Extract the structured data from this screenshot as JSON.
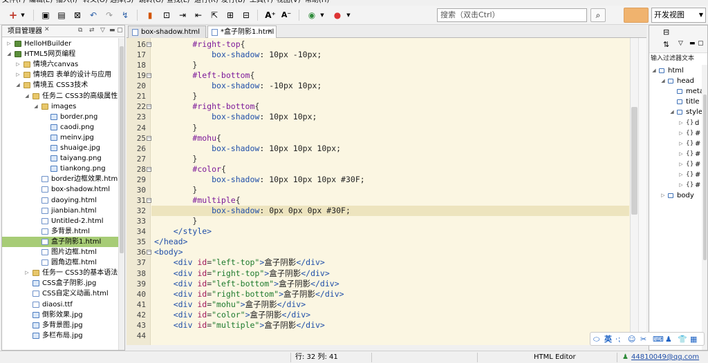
{
  "menu": [
    "文件(F)",
    "编辑(E)",
    "插入(I)",
    "转义(O)",
    "选择(S)",
    "跳转(G)",
    "查找(L)",
    "运行(R)",
    "发行(B)",
    "工具(T)",
    "视图(V)",
    "帮助(H)"
  ],
  "toolbar": {
    "search_placeholder": "搜索（双击Ctrl）",
    "view_select": "开发视图"
  },
  "left": {
    "title": "项目管理器",
    "tree": [
      {
        "label": "HelloHBuilder",
        "indent": 0,
        "arrow": "▷",
        "icon": "proj"
      },
      {
        "label": "HTML5网页编程",
        "indent": 0,
        "arrow": "◢",
        "icon": "proj"
      },
      {
        "label": "情境六canvas",
        "indent": 1,
        "arrow": "▷",
        "icon": "folder"
      },
      {
        "label": "情境四 表单的设计与应用",
        "indent": 1,
        "arrow": "▷",
        "icon": "folder"
      },
      {
        "label": "情境五 CSS3技术",
        "indent": 1,
        "arrow": "◢",
        "icon": "folder"
      },
      {
        "label": "任务二 CSS3的高级属性",
        "indent": 2,
        "arrow": "◢",
        "icon": "folder"
      },
      {
        "label": "images",
        "indent": 3,
        "arrow": "◢",
        "icon": "folder"
      },
      {
        "label": "border.png",
        "indent": 4,
        "arrow": "",
        "icon": "img"
      },
      {
        "label": "caodi.png",
        "indent": 4,
        "arrow": "",
        "icon": "img"
      },
      {
        "label": "meinv.jpg",
        "indent": 4,
        "arrow": "",
        "icon": "img"
      },
      {
        "label": "shuaige.jpg",
        "indent": 4,
        "arrow": "",
        "icon": "img"
      },
      {
        "label": "taiyang.png",
        "indent": 4,
        "arrow": "",
        "icon": "img"
      },
      {
        "label": "tiankong.png",
        "indent": 4,
        "arrow": "",
        "icon": "img"
      },
      {
        "label": "border边框效果.html",
        "indent": 3,
        "arrow": "",
        "icon": "file"
      },
      {
        "label": "box-shadow.html",
        "indent": 3,
        "arrow": "",
        "icon": "file"
      },
      {
        "label": "daoying.html",
        "indent": 3,
        "arrow": "",
        "icon": "file"
      },
      {
        "label": "jianbian.html",
        "indent": 3,
        "arrow": "",
        "icon": "file"
      },
      {
        "label": "Untitled-2.html",
        "indent": 3,
        "arrow": "",
        "icon": "file"
      },
      {
        "label": "多背景.html",
        "indent": 3,
        "arrow": "",
        "icon": "file"
      },
      {
        "label": "盒子阴影1.html",
        "indent": 3,
        "arrow": "",
        "icon": "file",
        "selected": true
      },
      {
        "label": "图片边框.html",
        "indent": 3,
        "arrow": "",
        "icon": "file"
      },
      {
        "label": "圆角边框.html",
        "indent": 3,
        "arrow": "",
        "icon": "file"
      },
      {
        "label": "任务一 CSS3的基本语法",
        "indent": 2,
        "arrow": "▷",
        "icon": "folder"
      },
      {
        "label": "CSS盒子阴影.jpg",
        "indent": 2,
        "arrow": "",
        "icon": "img"
      },
      {
        "label": "CSS自定义动画.html",
        "indent": 2,
        "arrow": "",
        "icon": "file"
      },
      {
        "label": "diaosi.ttf",
        "indent": 2,
        "arrow": "",
        "icon": "file"
      },
      {
        "label": "倒影效果.jpg",
        "indent": 2,
        "arrow": "",
        "icon": "img"
      },
      {
        "label": "多背景图.jpg",
        "indent": 2,
        "arrow": "",
        "icon": "img"
      },
      {
        "label": "多栏布局.jpg",
        "indent": 2,
        "arrow": "",
        "icon": "img"
      }
    ]
  },
  "tabs": [
    {
      "label": "box-shadow.html",
      "active": false
    },
    {
      "label": "*盒子阴影1.html",
      "active": true
    }
  ],
  "editor": {
    "current_line": 32,
    "lines": [
      {
        "n": "16",
        "fold": "−",
        "t": [
          [
            "        ",
            ""
          ],
          [
            "#right-top",
            "sel-c"
          ],
          [
            "{",
            "pun"
          ]
        ]
      },
      {
        "n": "17",
        "t": [
          [
            "            ",
            ""
          ],
          [
            "box-shadow",
            "prop"
          ],
          [
            ": 10px -10px;",
            "val"
          ]
        ]
      },
      {
        "n": "18",
        "t": [
          [
            "        ",
            ""
          ],
          [
            "}",
            "pun"
          ]
        ]
      },
      {
        "n": "19",
        "fold": "−",
        "t": [
          [
            "        ",
            ""
          ],
          [
            "#left-bottom",
            "sel-c"
          ],
          [
            "{",
            "pun"
          ]
        ]
      },
      {
        "n": "20",
        "t": [
          [
            "            ",
            ""
          ],
          [
            "box-shadow",
            "prop"
          ],
          [
            ": -10px 10px;",
            "val"
          ]
        ]
      },
      {
        "n": "21",
        "t": [
          [
            "        ",
            ""
          ],
          [
            "}",
            "pun"
          ]
        ]
      },
      {
        "n": "22",
        "fold": "−",
        "t": [
          [
            "        ",
            ""
          ],
          [
            "#right-bottom",
            "sel-c"
          ],
          [
            "{",
            "pun"
          ]
        ]
      },
      {
        "n": "23",
        "t": [
          [
            "            ",
            ""
          ],
          [
            "box-shadow",
            "prop"
          ],
          [
            ": 10px 10px;",
            "val"
          ]
        ]
      },
      {
        "n": "24",
        "t": [
          [
            "        ",
            ""
          ],
          [
            "}",
            "pun"
          ]
        ]
      },
      {
        "n": "25",
        "fold": "−",
        "t": [
          [
            "        ",
            ""
          ],
          [
            "#mohu",
            "sel-c"
          ],
          [
            "{",
            "pun"
          ]
        ]
      },
      {
        "n": "26",
        "t": [
          [
            "            ",
            ""
          ],
          [
            "box-shadow",
            "prop"
          ],
          [
            ": 10px 10px 10px;",
            "val"
          ]
        ]
      },
      {
        "n": "27",
        "t": [
          [
            "        ",
            ""
          ],
          [
            "}",
            "pun"
          ]
        ]
      },
      {
        "n": "28",
        "fold": "−",
        "t": [
          [
            "        ",
            ""
          ],
          [
            "#color",
            "sel-c"
          ],
          [
            "{",
            "pun"
          ]
        ]
      },
      {
        "n": "29",
        "t": [
          [
            "            ",
            ""
          ],
          [
            "box-shadow",
            "prop"
          ],
          [
            ": 10px 10px 10px #30F;",
            "val"
          ]
        ]
      },
      {
        "n": "30",
        "t": [
          [
            "        ",
            ""
          ],
          [
            "}",
            "pun"
          ]
        ]
      },
      {
        "n": "31",
        "fold": "−",
        "t": [
          [
            "        ",
            ""
          ],
          [
            "#multiple",
            "sel-c"
          ],
          [
            "{",
            "pun"
          ]
        ]
      },
      {
        "n": "32",
        "t": [
          [
            "            ",
            ""
          ],
          [
            "box-shadow",
            "prop"
          ],
          [
            ": 0px 0px 0px #30F;",
            "val"
          ]
        ]
      },
      {
        "n": "33",
        "t": [
          [
            "        ",
            ""
          ],
          [
            "}",
            "pun"
          ]
        ]
      },
      {
        "n": "34",
        "t": [
          [
            "    ",
            ""
          ],
          [
            "</style>",
            "tag"
          ]
        ]
      },
      {
        "n": "35",
        "t": [
          [
            "",
            ""
          ],
          [
            "</head>",
            "tag"
          ]
        ]
      },
      {
        "n": "36",
        "fold": "−",
        "t": [
          [
            "",
            ""
          ],
          [
            "<body>",
            "tag"
          ]
        ]
      },
      {
        "n": "37",
        "t": [
          [
            "    ",
            ""
          ],
          [
            "<div ",
            "tag"
          ],
          [
            "id",
            "attr"
          ],
          [
            "=",
            "pun"
          ],
          [
            "\"left-top\"",
            "str"
          ],
          [
            ">",
            "tag"
          ],
          [
            "盒子阴影",
            "val"
          ],
          [
            "</div>",
            "tag"
          ]
        ]
      },
      {
        "n": "38",
        "t": [
          [
            "    ",
            ""
          ],
          [
            "<div ",
            "tag"
          ],
          [
            "id",
            "attr"
          ],
          [
            "=",
            "pun"
          ],
          [
            "\"right-top\"",
            "str"
          ],
          [
            ">",
            "tag"
          ],
          [
            "盒子阴影",
            "val"
          ],
          [
            "</div>",
            "tag"
          ]
        ]
      },
      {
        "n": "39",
        "t": [
          [
            "    ",
            ""
          ],
          [
            "<div ",
            "tag"
          ],
          [
            "id",
            "attr"
          ],
          [
            "=",
            "pun"
          ],
          [
            "\"left-bottom\"",
            "str"
          ],
          [
            ">",
            "tag"
          ],
          [
            "盒子阴影",
            "val"
          ],
          [
            "</div>",
            "tag"
          ]
        ]
      },
      {
        "n": "40",
        "t": [
          [
            "    ",
            ""
          ],
          [
            "<div ",
            "tag"
          ],
          [
            "id",
            "attr"
          ],
          [
            "=",
            "pun"
          ],
          [
            "\"right-bottom\"",
            "str"
          ],
          [
            ">",
            "tag"
          ],
          [
            "盒子阴影",
            "val"
          ],
          [
            "</div>",
            "tag"
          ]
        ]
      },
      {
        "n": "41",
        "t": [
          [
            "    ",
            ""
          ],
          [
            "<div ",
            "tag"
          ],
          [
            "id",
            "attr"
          ],
          [
            "=",
            "pun"
          ],
          [
            "\"mohu\"",
            "str"
          ],
          [
            ">",
            "tag"
          ],
          [
            "盒子阴影",
            "val"
          ],
          [
            "</div>",
            "tag"
          ]
        ]
      },
      {
        "n": "42",
        "t": [
          [
            "    ",
            ""
          ],
          [
            "<div ",
            "tag"
          ],
          [
            "id",
            "attr"
          ],
          [
            "=",
            "pun"
          ],
          [
            "\"color\"",
            "str"
          ],
          [
            ">",
            "tag"
          ],
          [
            "盒子阴影",
            "val"
          ],
          [
            "</div>",
            "tag"
          ]
        ]
      },
      {
        "n": "43",
        "t": [
          [
            "    ",
            ""
          ],
          [
            "<div ",
            "tag"
          ],
          [
            "id",
            "attr"
          ],
          [
            "=",
            "pun"
          ],
          [
            "\"multiple\"",
            "str"
          ],
          [
            ">",
            "tag"
          ],
          [
            "盒子阴影",
            "val"
          ],
          [
            "</div>",
            "tag"
          ]
        ]
      },
      {
        "n": "44",
        "t": []
      }
    ]
  },
  "right": {
    "filter_text": "输入过滤器文本",
    "outline": [
      {
        "label": "html",
        "indent": 0,
        "arrow": "◢",
        "kind": "tag"
      },
      {
        "label": "head",
        "indent": 1,
        "arrow": "◢",
        "kind": "tag"
      },
      {
        "label": "meta",
        "indent": 2,
        "arrow": "",
        "kind": "tag"
      },
      {
        "label": "title",
        "indent": 2,
        "arrow": "",
        "kind": "tag"
      },
      {
        "label": "style",
        "indent": 2,
        "arrow": "◢",
        "kind": "tag"
      },
      {
        "label": "d",
        "indent": 3,
        "arrow": "▷",
        "kind": "css"
      },
      {
        "label": "#",
        "indent": 3,
        "arrow": "▷",
        "kind": "css"
      },
      {
        "label": "#",
        "indent": 3,
        "arrow": "▷",
        "kind": "css"
      },
      {
        "label": "#",
        "indent": 3,
        "arrow": "▷",
        "kind": "css"
      },
      {
        "label": "#",
        "indent": 3,
        "arrow": "▷",
        "kind": "css"
      },
      {
        "label": "#",
        "indent": 3,
        "arrow": "▷",
        "kind": "css"
      },
      {
        "label": "#",
        "indent": 3,
        "arrow": "▷",
        "kind": "css"
      },
      {
        "label": "body",
        "indent": 1,
        "arrow": "▷",
        "kind": "tag"
      }
    ]
  },
  "ime": {
    "lang": "英"
  },
  "status": {
    "position": "行: 32 列: 41",
    "editor_type": "HTML Editor",
    "account": "44810049@qq.com"
  }
}
